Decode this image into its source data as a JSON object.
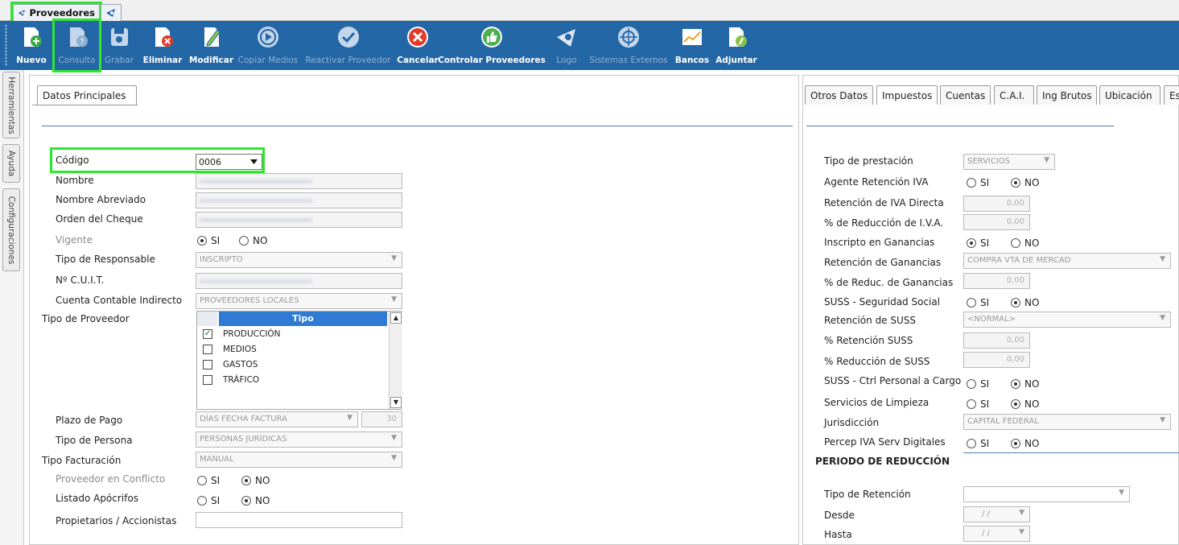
{
  "tabs": {
    "main": "Proveedores"
  },
  "toolbar": [
    {
      "label": "Nuevo",
      "icon": "new-doc-icon",
      "enabled": true
    },
    {
      "label": "Consulta",
      "icon": "query-doc-icon",
      "enabled": false
    },
    {
      "label": "Grabar",
      "icon": "save-icon",
      "enabled": false
    },
    {
      "label": "Eliminar",
      "icon": "delete-doc-icon",
      "enabled": true
    },
    {
      "label": "Modificar",
      "icon": "edit-doc-icon",
      "enabled": true
    },
    {
      "label": "Copiar Medios",
      "icon": "play-circle-icon",
      "enabled": false
    },
    {
      "label": "Reactivar Proveedor",
      "icon": "check-circle-icon",
      "enabled": false
    },
    {
      "label": "Cancelar",
      "icon": "cancel-circle-icon",
      "enabled": true
    },
    {
      "label": "Controlar Proveedores",
      "icon": "thumbs-up-icon",
      "enabled": true
    },
    {
      "label": "Logo",
      "icon": "logo-icon",
      "enabled": false
    },
    {
      "label": "Sistemas Externos",
      "icon": "external-systems-icon",
      "enabled": false
    },
    {
      "label": "Bancos",
      "icon": "chart-icon",
      "enabled": true
    },
    {
      "label": "Adjuntar",
      "icon": "attach-doc-icon",
      "enabled": true
    }
  ],
  "side_tabs": [
    "Herramientas",
    "Ayuda",
    "Configuraciones"
  ],
  "left": {
    "tab": "Datos Principales",
    "codigo_label": "Código",
    "codigo_value": "0006",
    "nombre_label": "Nombre",
    "nombre_abrev_label": "Nombre Abreviado",
    "orden_cheque_label": "Orden del Cheque",
    "vigente_label": "Vigente",
    "tipo_resp_label": "Tipo de Responsable",
    "tipo_resp_value": "INSCRIPTO",
    "cuit_label": "Nº C.U.I.T.",
    "cuenta_label": "Cuenta Contable Indirecto",
    "cuenta_value": "PROVEEDORES LOCALES",
    "tipo_prov_label": "Tipo de Proveedor",
    "tipo_grid_header": "Tipo",
    "tipo_items": [
      {
        "label": "PRODUCCIÓN",
        "checked": true
      },
      {
        "label": "MEDIOS",
        "checked": false
      },
      {
        "label": "GASTOS",
        "checked": false
      },
      {
        "label": "TRÁFICO",
        "checked": false
      }
    ],
    "plazo_label": "Plazo de Pago",
    "plazo_value": "DÍAS FECHA FACTURA",
    "plazo_days": "30",
    "tipo_persona_label": "Tipo de Persona",
    "tipo_persona_value": "PERSONAS JURÍDICAS",
    "tipo_fact_label": "Tipo Facturación",
    "tipo_fact_value": "MANUAL",
    "conflicto_label": "Proveedor en Conflicto",
    "apocrifos_label": "Listado Apócrifos",
    "propietarios_label": "Propietarios / Accionistas"
  },
  "radio": {
    "si": "SI",
    "no": "NO"
  },
  "right": {
    "tabs": [
      "Otros Datos",
      "Impuestos",
      "Cuentas",
      "C.A.I.",
      "Ing Brutos",
      "Ubicación",
      "Es"
    ],
    "tipo_prest_label": "Tipo de prestación",
    "tipo_prest_value": "SERVICIOS",
    "agente_iva_label": "Agente Retención IVA",
    "ret_iva_directa_label": "Retención de IVA Directa",
    "ret_iva_directa_value": "0,00",
    "red_iva_label": "% de Reducción de I.V.A.",
    "red_iva_value": "0,00",
    "insc_gan_label": "Inscripto en Ganancias",
    "ret_gan_label": "Retención de Ganancias",
    "ret_gan_value": "COMPRA VTA DE MERCAD",
    "red_gan_label": "% de Reduc. de Ganancias",
    "red_gan_value": "0,00",
    "suss_label": "SUSS - Seguridad Social",
    "ret_suss_label": "Retención de SUSS",
    "ret_suss_value": "<NORMAL>",
    "pct_ret_suss_label": "% Retención SUSS",
    "pct_ret_suss_value": "0,00",
    "pct_red_suss_label": "% Reducción de SUSS",
    "pct_red_suss_value": "0,00",
    "suss_ctrl_label": "SUSS - Ctrl Personal a Cargo",
    "limpieza_label": "Servicios de Limpieza",
    "jurisdiccion_label": "Jurisdicción",
    "jurisdiccion_value": "CAPITAL FEDERAL",
    "percep_label": "Percep IVA Serv Digitales",
    "periodo_title": "PERIODO DE REDUCCIÓN",
    "tipo_ret_label": "Tipo de Retención",
    "desde_label": "Desde",
    "desde_value": "/ /",
    "hasta_label": "Hasta",
    "hasta_value": "/ /"
  },
  "colors": {
    "toolbar": "#2467a6",
    "highlight": "#2ee62e",
    "accent_line": "#4a7cb0"
  }
}
